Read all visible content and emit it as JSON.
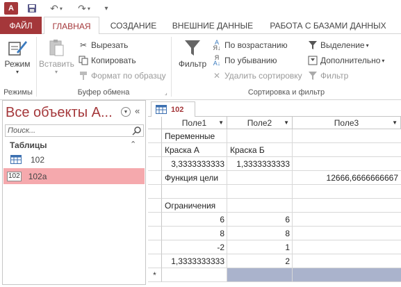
{
  "titlebar": {
    "logo_text": "A",
    "undo_icon": "undo-icon",
    "redo_icon": "redo-icon"
  },
  "tabs": [
    {
      "label": "ФАЙЛ"
    },
    {
      "label": "ГЛАВНАЯ"
    },
    {
      "label": "СОЗДАНИЕ"
    },
    {
      "label": "ВНЕШНИЕ ДАННЫЕ"
    },
    {
      "label": "РАБОТА С БАЗАМИ ДАННЫХ"
    }
  ],
  "ribbon": {
    "modes": {
      "view_label": "Режим",
      "group_label": "Режимы"
    },
    "clipboard": {
      "paste_label": "Вставить",
      "cut_label": "Вырезать",
      "copy_label": "Копировать",
      "format_painter_label": "Формат по образцу",
      "group_label": "Буфер обмена"
    },
    "sort_filter": {
      "filter_label": "Фильтр",
      "ascending_label": "По возрастанию",
      "descending_label": "По убыванию",
      "remove_sort_label": "Удалить сортировку",
      "selection_label": "Выделение",
      "advanced_label": "Дополнительно",
      "toggle_filter_label": "Фильтр",
      "group_label": "Сортировка и фильтр"
    }
  },
  "nav": {
    "title": "Все объекты А...",
    "search_placeholder": "Поиск...",
    "section_label": "Таблицы",
    "items": [
      {
        "label": "102",
        "icon": "table-icon",
        "badge": ""
      },
      {
        "label": "102a",
        "icon": "table-link-icon",
        "badge": "102"
      }
    ]
  },
  "document": {
    "tab_label": "102",
    "columns": [
      "Поле1",
      "Поле2",
      "Поле3"
    ],
    "rows": [
      [
        "Переменные",
        "",
        ""
      ],
      [
        "Краска А",
        "Краска Б",
        ""
      ],
      [
        "3,3333333333",
        "1,3333333333",
        ""
      ],
      [
        "Функция цели",
        "",
        "12666,6666666667"
      ],
      [
        "",
        "",
        ""
      ],
      [
        "Ограничения",
        "",
        ""
      ],
      [
        "6",
        "6",
        ""
      ],
      [
        "8",
        "8",
        ""
      ],
      [
        "-2",
        "1",
        ""
      ],
      [
        "1,3333333333",
        "2",
        ""
      ]
    ],
    "new_row_marker": "*"
  }
}
